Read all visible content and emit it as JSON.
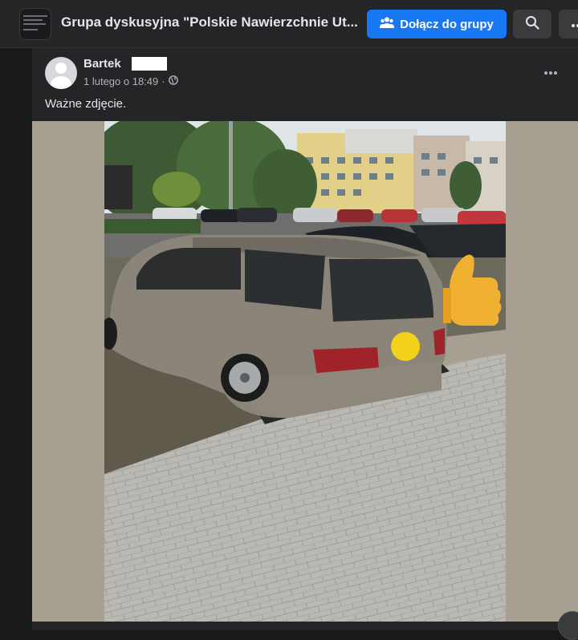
{
  "header": {
    "group_title": "Grupa dyskusyjna \"Polskie Nawierzchnie Ut...",
    "join_label": "Dołącz do grupy",
    "icons": [
      "group-icon",
      "search-icon",
      "more-icon"
    ]
  },
  "post": {
    "author": "Bartek",
    "timestamp": "1 lutego o 18:49",
    "separator": "·",
    "privacy_icon": "globe-icon",
    "text": "Ważne zdjęcie.",
    "photo": {
      "subject": "silver Mercedes station wagon parked over paved steps",
      "overlays": [
        "thumbs-up-emoji",
        "yellow-circle-sticker"
      ]
    }
  },
  "colors": {
    "accent": "#1877f2",
    "background": "#18191a",
    "surface": "#242526",
    "photo_matte": "#a79f91"
  }
}
